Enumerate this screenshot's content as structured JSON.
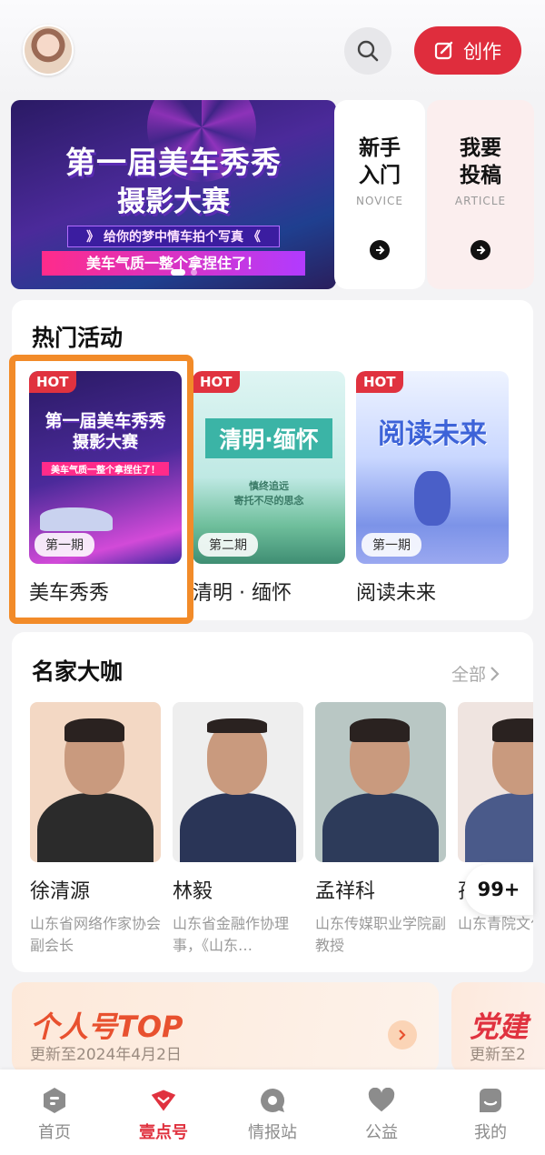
{
  "header": {
    "create_label": "创作"
  },
  "banner": {
    "line1": "第一届美车秀秀",
    "line2": "摄影大赛",
    "line3": "》 给你的梦中情车拍个写真 《",
    "line4": "美车气质一整个拿捏住了！"
  },
  "tiles": [
    {
      "title_1": "新手",
      "title_2": "入门",
      "en": "NOVICE"
    },
    {
      "title_1": "我要",
      "title_2": "投稿",
      "en": "ARTICLE"
    }
  ],
  "hot_activities": {
    "title": "热门活动",
    "items": [
      {
        "hot": "HOT",
        "period": "第一期",
        "name": "美车秀秀",
        "poster_1": "第一届美车秀秀",
        "poster_2": "摄影大赛",
        "poster_3": "美车气质一整个拿捏住了！"
      },
      {
        "hot": "HOT",
        "period": "第二期",
        "name": "清明 · 缅怀",
        "poster_1": "清明·缅怀",
        "poster_2": "慎终追远",
        "poster_3": "寄托不尽的思念"
      },
      {
        "hot": "HOT",
        "period": "第一期",
        "name": "阅读未来",
        "poster_1": "阅读未来"
      }
    ]
  },
  "masters": {
    "title": "名家大咖",
    "all_label": "全部",
    "items": [
      {
        "name": "徐清源",
        "desc": "山东省网络作家协会副会长",
        "bg": "#f3d8c4",
        "shirt": "#2b2b2b"
      },
      {
        "name": "林毅",
        "desc": "山东省金融作协理事，《山东…",
        "bg": "#eeeeee",
        "shirt": "#2a3557"
      },
      {
        "name": "孟祥科",
        "desc": "山东传媒职业学院副教授",
        "bg": "#b9c7c4",
        "shirt": "#2d3b5a"
      },
      {
        "name": "孙",
        "desc": "山东青院文化",
        "bg": "#efe4e0",
        "shirt": "#4a5a8a"
      }
    ],
    "badge": "99+"
  },
  "ranking": [
    {
      "title": "个人号TOP",
      "sub": "更新至2024年4月2日"
    },
    {
      "title": "党建",
      "sub": "更新至2"
    }
  ],
  "nav": {
    "items": [
      {
        "label": "首页"
      },
      {
        "label": "壹点号"
      },
      {
        "label": "情报站"
      },
      {
        "label": "公益"
      },
      {
        "label": "我的"
      }
    ],
    "active": "壹点号"
  },
  "colors": {
    "accent": "#df2d3d",
    "highlight": "#f28b29"
  }
}
